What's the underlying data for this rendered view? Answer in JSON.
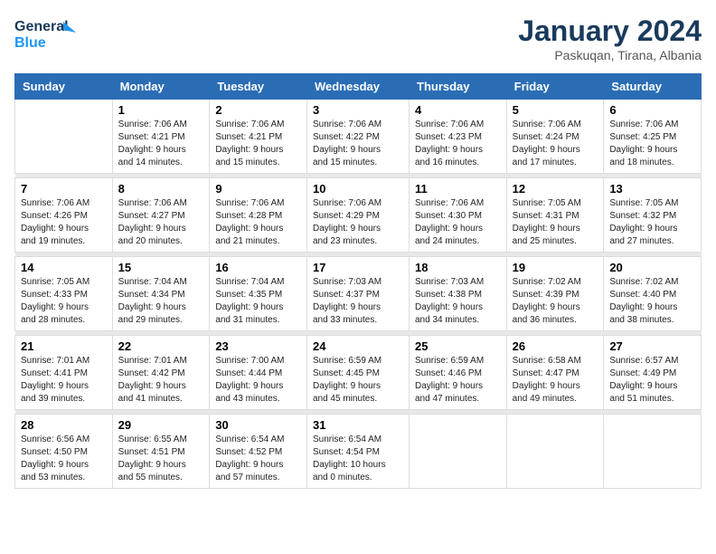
{
  "header": {
    "logo_line1": "General",
    "logo_line2": "Blue",
    "title": "January 2024",
    "subtitle": "Paskuqan, Tirana, Albania"
  },
  "days_of_week": [
    "Sunday",
    "Monday",
    "Tuesday",
    "Wednesday",
    "Thursday",
    "Friday",
    "Saturday"
  ],
  "weeks": [
    [
      {
        "day": "",
        "info": ""
      },
      {
        "day": "1",
        "info": "Sunrise: 7:06 AM\nSunset: 4:21 PM\nDaylight: 9 hours\nand 14 minutes."
      },
      {
        "day": "2",
        "info": "Sunrise: 7:06 AM\nSunset: 4:21 PM\nDaylight: 9 hours\nand 15 minutes."
      },
      {
        "day": "3",
        "info": "Sunrise: 7:06 AM\nSunset: 4:22 PM\nDaylight: 9 hours\nand 15 minutes."
      },
      {
        "day": "4",
        "info": "Sunrise: 7:06 AM\nSunset: 4:23 PM\nDaylight: 9 hours\nand 16 minutes."
      },
      {
        "day": "5",
        "info": "Sunrise: 7:06 AM\nSunset: 4:24 PM\nDaylight: 9 hours\nand 17 minutes."
      },
      {
        "day": "6",
        "info": "Sunrise: 7:06 AM\nSunset: 4:25 PM\nDaylight: 9 hours\nand 18 minutes."
      }
    ],
    [
      {
        "day": "7",
        "info": "Sunrise: 7:06 AM\nSunset: 4:26 PM\nDaylight: 9 hours\nand 19 minutes."
      },
      {
        "day": "8",
        "info": "Sunrise: 7:06 AM\nSunset: 4:27 PM\nDaylight: 9 hours\nand 20 minutes."
      },
      {
        "day": "9",
        "info": "Sunrise: 7:06 AM\nSunset: 4:28 PM\nDaylight: 9 hours\nand 21 minutes."
      },
      {
        "day": "10",
        "info": "Sunrise: 7:06 AM\nSunset: 4:29 PM\nDaylight: 9 hours\nand 23 minutes."
      },
      {
        "day": "11",
        "info": "Sunrise: 7:06 AM\nSunset: 4:30 PM\nDaylight: 9 hours\nand 24 minutes."
      },
      {
        "day": "12",
        "info": "Sunrise: 7:05 AM\nSunset: 4:31 PM\nDaylight: 9 hours\nand 25 minutes."
      },
      {
        "day": "13",
        "info": "Sunrise: 7:05 AM\nSunset: 4:32 PM\nDaylight: 9 hours\nand 27 minutes."
      }
    ],
    [
      {
        "day": "14",
        "info": "Sunrise: 7:05 AM\nSunset: 4:33 PM\nDaylight: 9 hours\nand 28 minutes."
      },
      {
        "day": "15",
        "info": "Sunrise: 7:04 AM\nSunset: 4:34 PM\nDaylight: 9 hours\nand 29 minutes."
      },
      {
        "day": "16",
        "info": "Sunrise: 7:04 AM\nSunset: 4:35 PM\nDaylight: 9 hours\nand 31 minutes."
      },
      {
        "day": "17",
        "info": "Sunrise: 7:03 AM\nSunset: 4:37 PM\nDaylight: 9 hours\nand 33 minutes."
      },
      {
        "day": "18",
        "info": "Sunrise: 7:03 AM\nSunset: 4:38 PM\nDaylight: 9 hours\nand 34 minutes."
      },
      {
        "day": "19",
        "info": "Sunrise: 7:02 AM\nSunset: 4:39 PM\nDaylight: 9 hours\nand 36 minutes."
      },
      {
        "day": "20",
        "info": "Sunrise: 7:02 AM\nSunset: 4:40 PM\nDaylight: 9 hours\nand 38 minutes."
      }
    ],
    [
      {
        "day": "21",
        "info": "Sunrise: 7:01 AM\nSunset: 4:41 PM\nDaylight: 9 hours\nand 39 minutes."
      },
      {
        "day": "22",
        "info": "Sunrise: 7:01 AM\nSunset: 4:42 PM\nDaylight: 9 hours\nand 41 minutes."
      },
      {
        "day": "23",
        "info": "Sunrise: 7:00 AM\nSunset: 4:44 PM\nDaylight: 9 hours\nand 43 minutes."
      },
      {
        "day": "24",
        "info": "Sunrise: 6:59 AM\nSunset: 4:45 PM\nDaylight: 9 hours\nand 45 minutes."
      },
      {
        "day": "25",
        "info": "Sunrise: 6:59 AM\nSunset: 4:46 PM\nDaylight: 9 hours\nand 47 minutes."
      },
      {
        "day": "26",
        "info": "Sunrise: 6:58 AM\nSunset: 4:47 PM\nDaylight: 9 hours\nand 49 minutes."
      },
      {
        "day": "27",
        "info": "Sunrise: 6:57 AM\nSunset: 4:49 PM\nDaylight: 9 hours\nand 51 minutes."
      }
    ],
    [
      {
        "day": "28",
        "info": "Sunrise: 6:56 AM\nSunset: 4:50 PM\nDaylight: 9 hours\nand 53 minutes."
      },
      {
        "day": "29",
        "info": "Sunrise: 6:55 AM\nSunset: 4:51 PM\nDaylight: 9 hours\nand 55 minutes."
      },
      {
        "day": "30",
        "info": "Sunrise: 6:54 AM\nSunset: 4:52 PM\nDaylight: 9 hours\nand 57 minutes."
      },
      {
        "day": "31",
        "info": "Sunrise: 6:54 AM\nSunset: 4:54 PM\nDaylight: 10 hours\nand 0 minutes."
      },
      {
        "day": "",
        "info": ""
      },
      {
        "day": "",
        "info": ""
      },
      {
        "day": "",
        "info": ""
      }
    ]
  ]
}
